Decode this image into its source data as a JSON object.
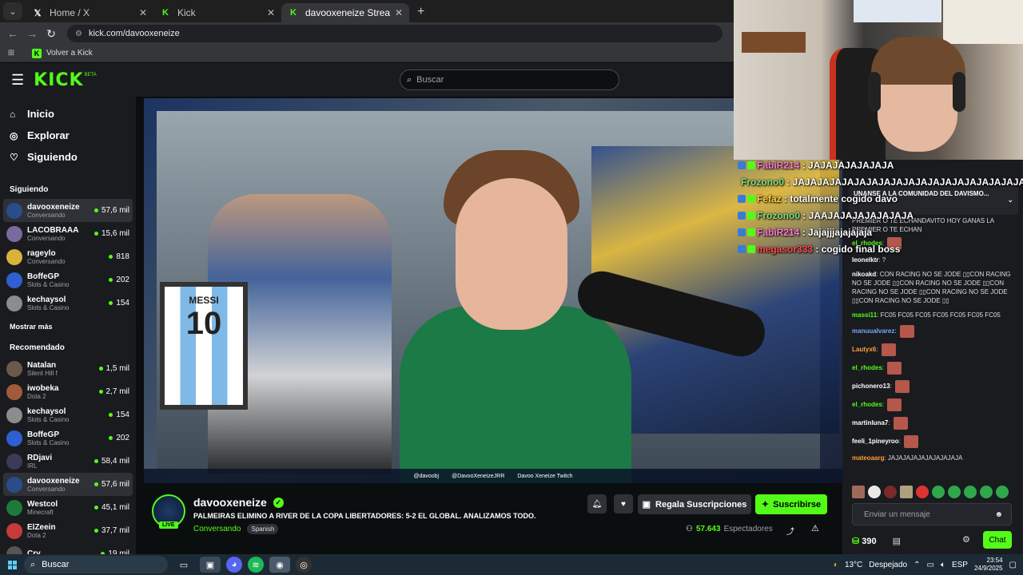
{
  "browser": {
    "tabs": [
      {
        "label": "Home / X",
        "icon": "x-logo-icon"
      },
      {
        "label": "Kick",
        "icon": "kick-logo-icon"
      },
      {
        "label": "davooxeneize Stream - Watch Live",
        "icon": "kick-logo-icon",
        "active": true
      }
    ],
    "url": "kick.com/davooxeneize",
    "bookmark": "Volver a Kick"
  },
  "header": {
    "logo": "KICK",
    "beta": "BETA",
    "search_placeholder": "Buscar"
  },
  "sidebar": {
    "nav": [
      {
        "label": "Inicio",
        "icon": "home-icon"
      },
      {
        "label": "Explorar",
        "icon": "compass-icon"
      },
      {
        "label": "Siguiendo",
        "icon": "heart-icon"
      }
    ],
    "following_title": "Siguiendo",
    "following": [
      {
        "name": "davooxeneize",
        "category": "Conversando",
        "viewers": "57,6 mil",
        "color": "#2a4d8a"
      },
      {
        "name": "LACOBRAAA",
        "category": "Conversando",
        "viewers": "15,6 mil",
        "color": "#7b6a9e"
      },
      {
        "name": "rageylo",
        "category": "Conversando",
        "viewers": "818",
        "color": "#d9b23a"
      },
      {
        "name": "BoffeGP",
        "category": "Slots & Casino",
        "viewers": "202",
        "color": "#2f5fd0"
      },
      {
        "name": "kechaysol",
        "category": "Slots & Casino",
        "viewers": "154",
        "color": "#8c8c8c"
      }
    ],
    "show_more": "Mostrar más",
    "recommended_title": "Recomendado",
    "recommended": [
      {
        "name": "Natalan",
        "category": "Silent Hill f",
        "viewers": "1,5 mil",
        "color": "#6b5a4a"
      },
      {
        "name": "iwobeka",
        "category": "Dota 2",
        "viewers": "2,7 mil",
        "color": "#a35a3a"
      },
      {
        "name": "kechaysol",
        "category": "Slots & Casino",
        "viewers": "154",
        "color": "#8c8c8c"
      },
      {
        "name": "BoffeGP",
        "category": "Slots & Casino",
        "viewers": "202",
        "color": "#2f5fd0"
      },
      {
        "name": "RDjavi",
        "category": "IRL",
        "viewers": "58,4 mil",
        "color": "#3a3a5a"
      },
      {
        "name": "davooxeneize",
        "category": "Conversando",
        "viewers": "57,6 mil",
        "color": "#2a4d8a"
      },
      {
        "name": "Westcol",
        "category": "Minecraft",
        "viewers": "45,1 mil",
        "color": "#1e7a3a"
      },
      {
        "name": "ElZeein",
        "category": "Dota 2",
        "viewers": "37,7 mil",
        "color": "#c63a3a"
      },
      {
        "name": "Cry",
        "category": "",
        "viewers": "19 mil",
        "color": "#555555"
      }
    ]
  },
  "player": {
    "overlay_bar": [
      "@davoobj",
      "@DavooXeneizeJRR",
      "Davoo Xeneize Twitch"
    ],
    "shirt_number": "10",
    "shirt_name": "MESSI"
  },
  "stream": {
    "streamer": "davooxeneize",
    "live": "LIVE",
    "title": "PALMEIRAS ELIMINO A RIVER DE LA COPA LIBERTADORES: 5-2 EL GLOBAL. ANALIZAMOS TODO.",
    "category": "Conversando",
    "language": "Spanish",
    "gift_button": "Regala Suscripciones",
    "subscribe_button": "Suscribirse",
    "viewers": "57.643",
    "viewers_label": "Espectadores"
  },
  "chat": {
    "pinned": "UNANSE A LA COMUNIDAD DEL DAVISMO...",
    "pinned_reply": "PREMIER O TE ECHANDAVITO HOY GANAS LA PREMIER O TE ECHAN",
    "messages": [
      {
        "user": "el_rhodes",
        "text": "",
        "color": "#53fc18",
        "emote": true
      },
      {
        "user": "leonelktr",
        "text": "?",
        "color": "#ffffff",
        "emote": false
      },
      {
        "user": "nikoakd",
        "text": "CON RACING NO SE JODE ▯▯CON RACING NO SE JODE ▯▯CON RACING NO SE JODE ▯▯CON RACING NO SE JODE ▯▯CON RACING NO SE JODE ▯▯CON RACING NO SE JODE ▯▯",
        "color": "#ffffff",
        "emote": false
      },
      {
        "user": "massi11",
        "text": "FC05 FC05 FC05 FC05 FC05 FC05 FC05",
        "color": "#53fc18",
        "emote": false
      },
      {
        "user": "manuualvarez",
        "text": "",
        "color": "#7aa7ff",
        "emote": true
      },
      {
        "user": "Lautyx6",
        "text": "",
        "color": "#ff9e3d",
        "emote": true
      },
      {
        "user": "el_rhodes",
        "text": "",
        "color": "#53fc18",
        "emote": true
      },
      {
        "user": "pichonero13",
        "text": "",
        "color": "#ffffff",
        "emote": true
      },
      {
        "user": "el_rhodes",
        "text": "",
        "color": "#53fc18",
        "emote": true
      },
      {
        "user": "martinluna7",
        "text": "",
        "color": "#ffffff",
        "emote": true
      },
      {
        "user": "feeli_1pineyroo",
        "text": "",
        "color": "#ffffff",
        "emote": true
      },
      {
        "user": "mateoaarg",
        "text": "JAJAJAJAJAJAJAJAJAJA",
        "color": "#ff9e3d",
        "emote": false
      }
    ],
    "input_placeholder": "Enviar un mensaje",
    "points": "390",
    "chat_button": "Chat"
  },
  "overlay_chat": [
    {
      "user": "FabiR214",
      "text": "JAJAJAJAJAJAJA",
      "color": "#ff7ad9"
    },
    {
      "user": "Frozono0",
      "text": "JAJAJAJAJAJAJAJAJAJAJAJAJAJAJAJAJAJAJA",
      "color": "#7ee081"
    },
    {
      "user": "Fefaz",
      "text": "totalmente cogido davo",
      "color": "#ffd24a"
    },
    {
      "user": "Frozono0",
      "text": "JAAJAJAJAJAJAJAJA",
      "color": "#7ee081"
    },
    {
      "user": "FabiR214",
      "text": "Jajajjjajajajaja",
      "color": "#ff7ad9"
    },
    {
      "user": "megasor333",
      "text": "cogido final boss",
      "color": "#ff4a4a"
    }
  ],
  "taskbar": {
    "search": "Buscar",
    "weather": "13°C",
    "weather_desc": "Despejado",
    "lang": "ESP",
    "time": "23:54",
    "date": "24/9/2025"
  }
}
